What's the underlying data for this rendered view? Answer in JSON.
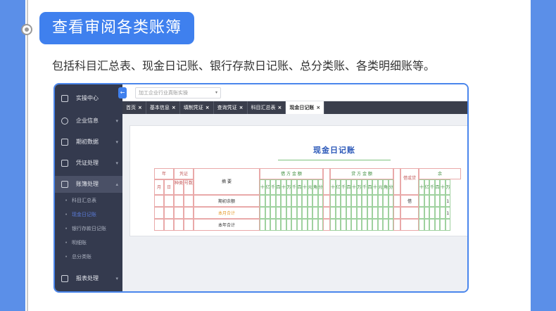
{
  "section": {
    "title": "查看审阅各类账簿",
    "description": "包括科目汇总表、现金日记账、银行存款日记账、总分类账、各类明细账等。"
  },
  "app": {
    "sidebar": {
      "items": [
        {
          "label": "实操中心",
          "icon": "checklist-icon"
        },
        {
          "label": "企业信息",
          "icon": "group-icon"
        },
        {
          "label": "期初数据",
          "icon": "bar-chart-icon"
        },
        {
          "label": "凭证处理",
          "icon": "voucher-icon"
        },
        {
          "label": "账簿处理",
          "icon": "book-icon"
        },
        {
          "label": "报表处理",
          "icon": "line-chart-icon"
        }
      ],
      "subitems": [
        "科目汇总表",
        "现金日记账",
        "银行存款日记账",
        "明细账",
        "总分类账"
      ]
    },
    "topbar": {
      "industry_placeholder": "加工企业行业真账实操",
      "collapse_glyph": "←"
    },
    "tabs": [
      "首页",
      "基本信息",
      "填制凭证",
      "查询凭证",
      "科目汇总表",
      "现金日记账"
    ],
    "ledger": {
      "title": "现金日记账",
      "headers": {
        "year": "年",
        "month": "月",
        "day": "日",
        "voucher": "凭证",
        "kind": "种类",
        "number": "号数",
        "summary": "摘 要",
        "debit": "借 方 金 额",
        "credit": "贷 方 金 额",
        "direction": "借或贷",
        "balance": "余"
      },
      "digit_units": [
        "十",
        "亿",
        "千",
        "百",
        "十",
        "万",
        "千",
        "百",
        "十",
        "元",
        "角",
        "分"
      ],
      "rows": [
        {
          "summary": "期初余额",
          "direction": "借",
          "balance_digit": "1"
        },
        {
          "summary": "本月合计",
          "direction": "",
          "balance_digit": "1"
        },
        {
          "summary": "本年合计",
          "direction": "",
          "balance_digit": ""
        }
      ]
    }
  }
}
